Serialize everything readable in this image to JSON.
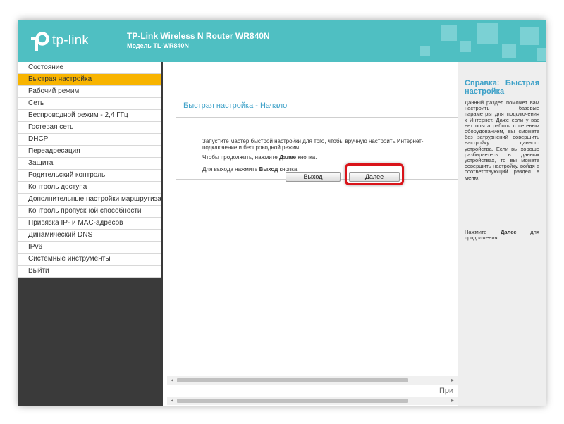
{
  "header": {
    "logo_text": "tp-link",
    "title": "TP-Link Wireless N Router WR840N",
    "subtitle": "Модель TL-WR840N"
  },
  "sidebar": {
    "items": [
      {
        "label": "Состояние"
      },
      {
        "label": "Быстрая настройка",
        "active": true
      },
      {
        "label": "Рабочий режим"
      },
      {
        "label": "Сеть"
      },
      {
        "label": "Беспроводной режим - 2,4 ГГц"
      },
      {
        "label": "Гостевая сеть"
      },
      {
        "label": "DHCP"
      },
      {
        "label": "Переадресация"
      },
      {
        "label": "Защита"
      },
      {
        "label": "Родительский контроль"
      },
      {
        "label": "Контроль доступа"
      },
      {
        "label": "Дополнительные настройки маршрутизации"
      },
      {
        "label": "Контроль пропускной способности"
      },
      {
        "label": "Привязка IP- и MAC-адресов"
      },
      {
        "label": "Динамический DNS"
      },
      {
        "label": "IPv6"
      },
      {
        "label": "Системные инструменты"
      },
      {
        "label": "Выйти"
      }
    ]
  },
  "main": {
    "title": "Быстрая настройка - Начало",
    "text1": "Запустите мастер быстрой настройки для того, чтобы вручную настроить Интернет-подключение и беспроводной режим.",
    "text2_prefix": "Чтобы продолжить, нажмите ",
    "text2_bold": "Далее",
    "text2_suffix": " кнопка.",
    "text3_prefix": "Для выхода нажмите ",
    "text3_bold": "Выход",
    "text3_suffix": " кнопка.",
    "exit_button": "Выход",
    "next_button": "Далее",
    "link_text": "При"
  },
  "help": {
    "title": "Справка: Быстрая настройка",
    "body": "Данный раздел поможет вам настроить базовые параметры для подключения к Интернет. Даже если у вас нет опыта работы с сетевым оборудованием, вы сможете без затруднений совершить настройку данного устройства. Если вы хорошо разбираетесь в данных устройствах, то вы можете совершить настройку, войдя в соответствующий раздел в меню.",
    "cont_prefix": "Нажмите ",
    "cont_bold": "Далее",
    "cont_suffix": " для продолжения."
  },
  "colors": {
    "header": "#4fbfc2",
    "active_menu": "#f8b400",
    "title_blue": "#3ea1c8",
    "highlight": "#d9141a"
  },
  "icons": {
    "logo": "tp-link-logo-icon",
    "scroll_left": "arrow-left-icon",
    "scroll_right": "arrow-right-icon"
  }
}
